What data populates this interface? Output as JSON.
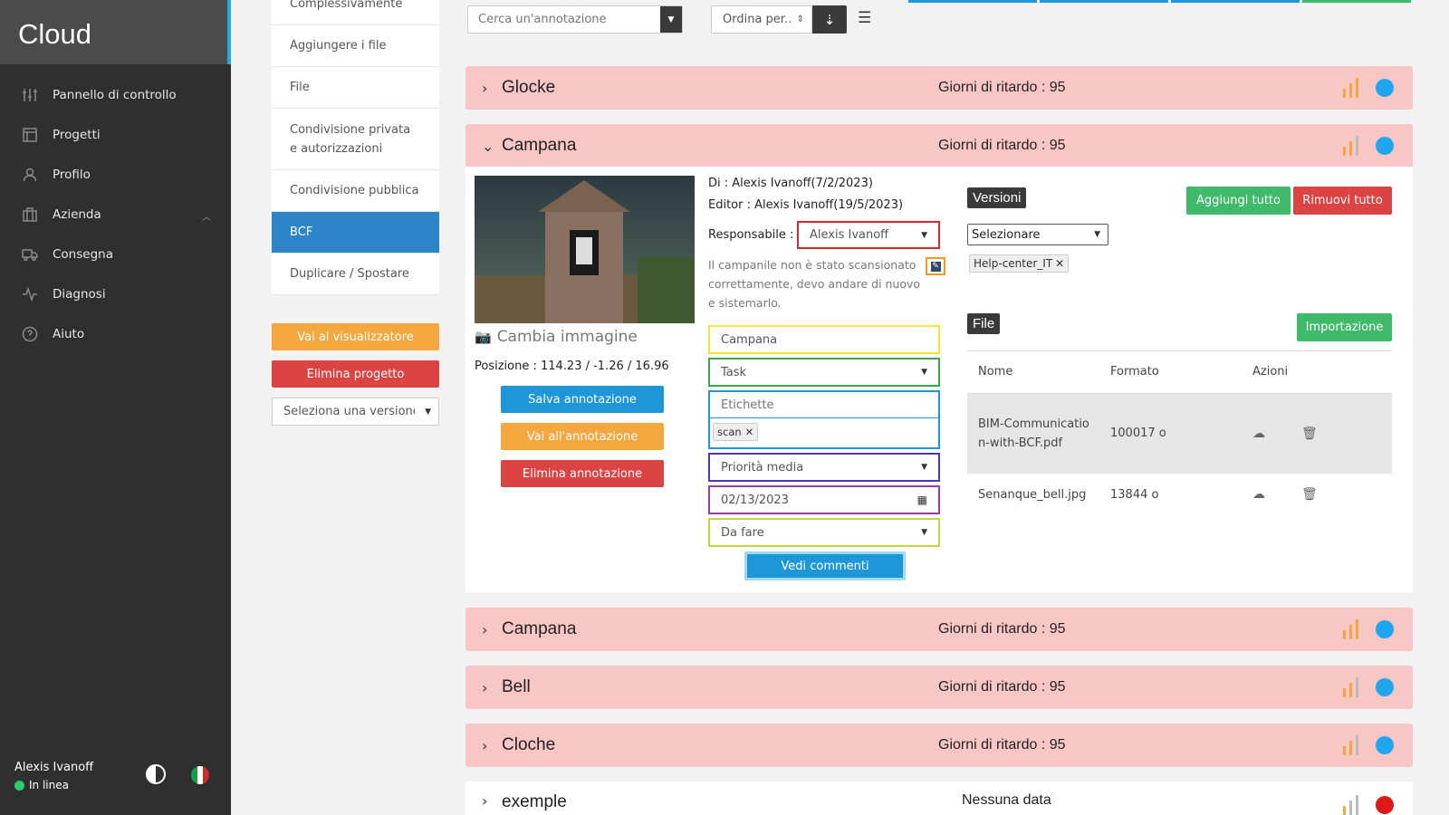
{
  "sidebar": {
    "brand": "Cloud",
    "items": [
      {
        "label": "Pannello di controllo",
        "icon": "sliders-icon"
      },
      {
        "label": "Progetti",
        "icon": "layout-icon"
      },
      {
        "label": "Profilo",
        "icon": "user-icon"
      },
      {
        "label": "Azienda",
        "icon": "building-icon"
      },
      {
        "label": "Consegna",
        "icon": "truck-icon"
      },
      {
        "label": "Diagnosi",
        "icon": "activity-icon"
      },
      {
        "label": "Aiuto",
        "icon": "help-icon"
      }
    ],
    "user_name": "Alexis Ivanoff",
    "user_status": "In linea"
  },
  "submenu": {
    "items": [
      "Complessivamente",
      "Aggiungere i file",
      "File",
      "Condivisione privata e autorizzazioni",
      "Condivisione pubblica",
      "BCF",
      "Duplicare / Spostare"
    ],
    "active": "BCF",
    "viewer_button": "Vai al visualizzatore",
    "delete_project_button": "Elimina progetto",
    "version_select": "Seleziona una versione"
  },
  "toolbar": {
    "search_placeholder": "Cerca un'annotazione",
    "sort_label": "Ordina per.."
  },
  "annotations": [
    {
      "title": "Glocke",
      "delay": "Giorni di ritardo : 95",
      "status_color": "#1ea7f0",
      "expanded": false
    },
    {
      "title": "Campana",
      "delay": "Giorni di ritardo : 95",
      "status_color": "#1ea7f0",
      "expanded": true
    },
    {
      "title": "Campana",
      "delay": "Giorni di ritardo : 95",
      "status_color": "#1ea7f0",
      "expanded": false
    },
    {
      "title": "Bell",
      "delay": "Giorni di ritardo : 95",
      "status_color": "#1ea7f0",
      "expanded": false
    },
    {
      "title": "Cloche",
      "delay": "Giorni di ritardo : 95",
      "status_color": "#1ea7f0",
      "expanded": false
    },
    {
      "title": "exemple",
      "delay": "Nessuna data",
      "status_color": "#e01818",
      "expanded": false
    }
  ],
  "detail": {
    "change_image": "Cambia immagine",
    "position": "Posizione : 114.23 / -1.26 / 16.96",
    "save_button": "Salva annotazione",
    "goto_button": "Vai all'annotazione",
    "delete_button": "Elimina annotazione",
    "author": "Di : Alexis Ivanoff(7/2/2023)",
    "editor": "Editor : Alexis Ivanoff(19/5/2023)",
    "assignee_label": "Responsabile :",
    "assignee_value": "Alexis Ivanoff",
    "description": "Il campanile non è stato scansionato correttamente, devo andare di nuovo e sistemarlo.",
    "title_value": "Campana",
    "type_value": "Task",
    "tags_placeholder": "Etichette",
    "tag": "scan",
    "priority_value": "Priorità media",
    "date_value": "02/13/2023",
    "status_value": "Da fare",
    "comments_button": "Vedi commenti",
    "versions_label": "Versioni",
    "add_all_button": "Aggiungi tutto",
    "remove_all_button": "Rimuovi tutto",
    "version_select": "Selezionare",
    "version_tag": "Help-center_IT",
    "files_label": "File",
    "import_button": "Importazione",
    "files_table": {
      "headers": [
        "Nome",
        "Formato",
        "Azioni"
      ],
      "rows": [
        {
          "name": "BIM-Communication-with-BCF.pdf",
          "size": "100017 o"
        },
        {
          "name": "Senanque_bell.jpg",
          "size": "13844 o"
        }
      ]
    }
  }
}
